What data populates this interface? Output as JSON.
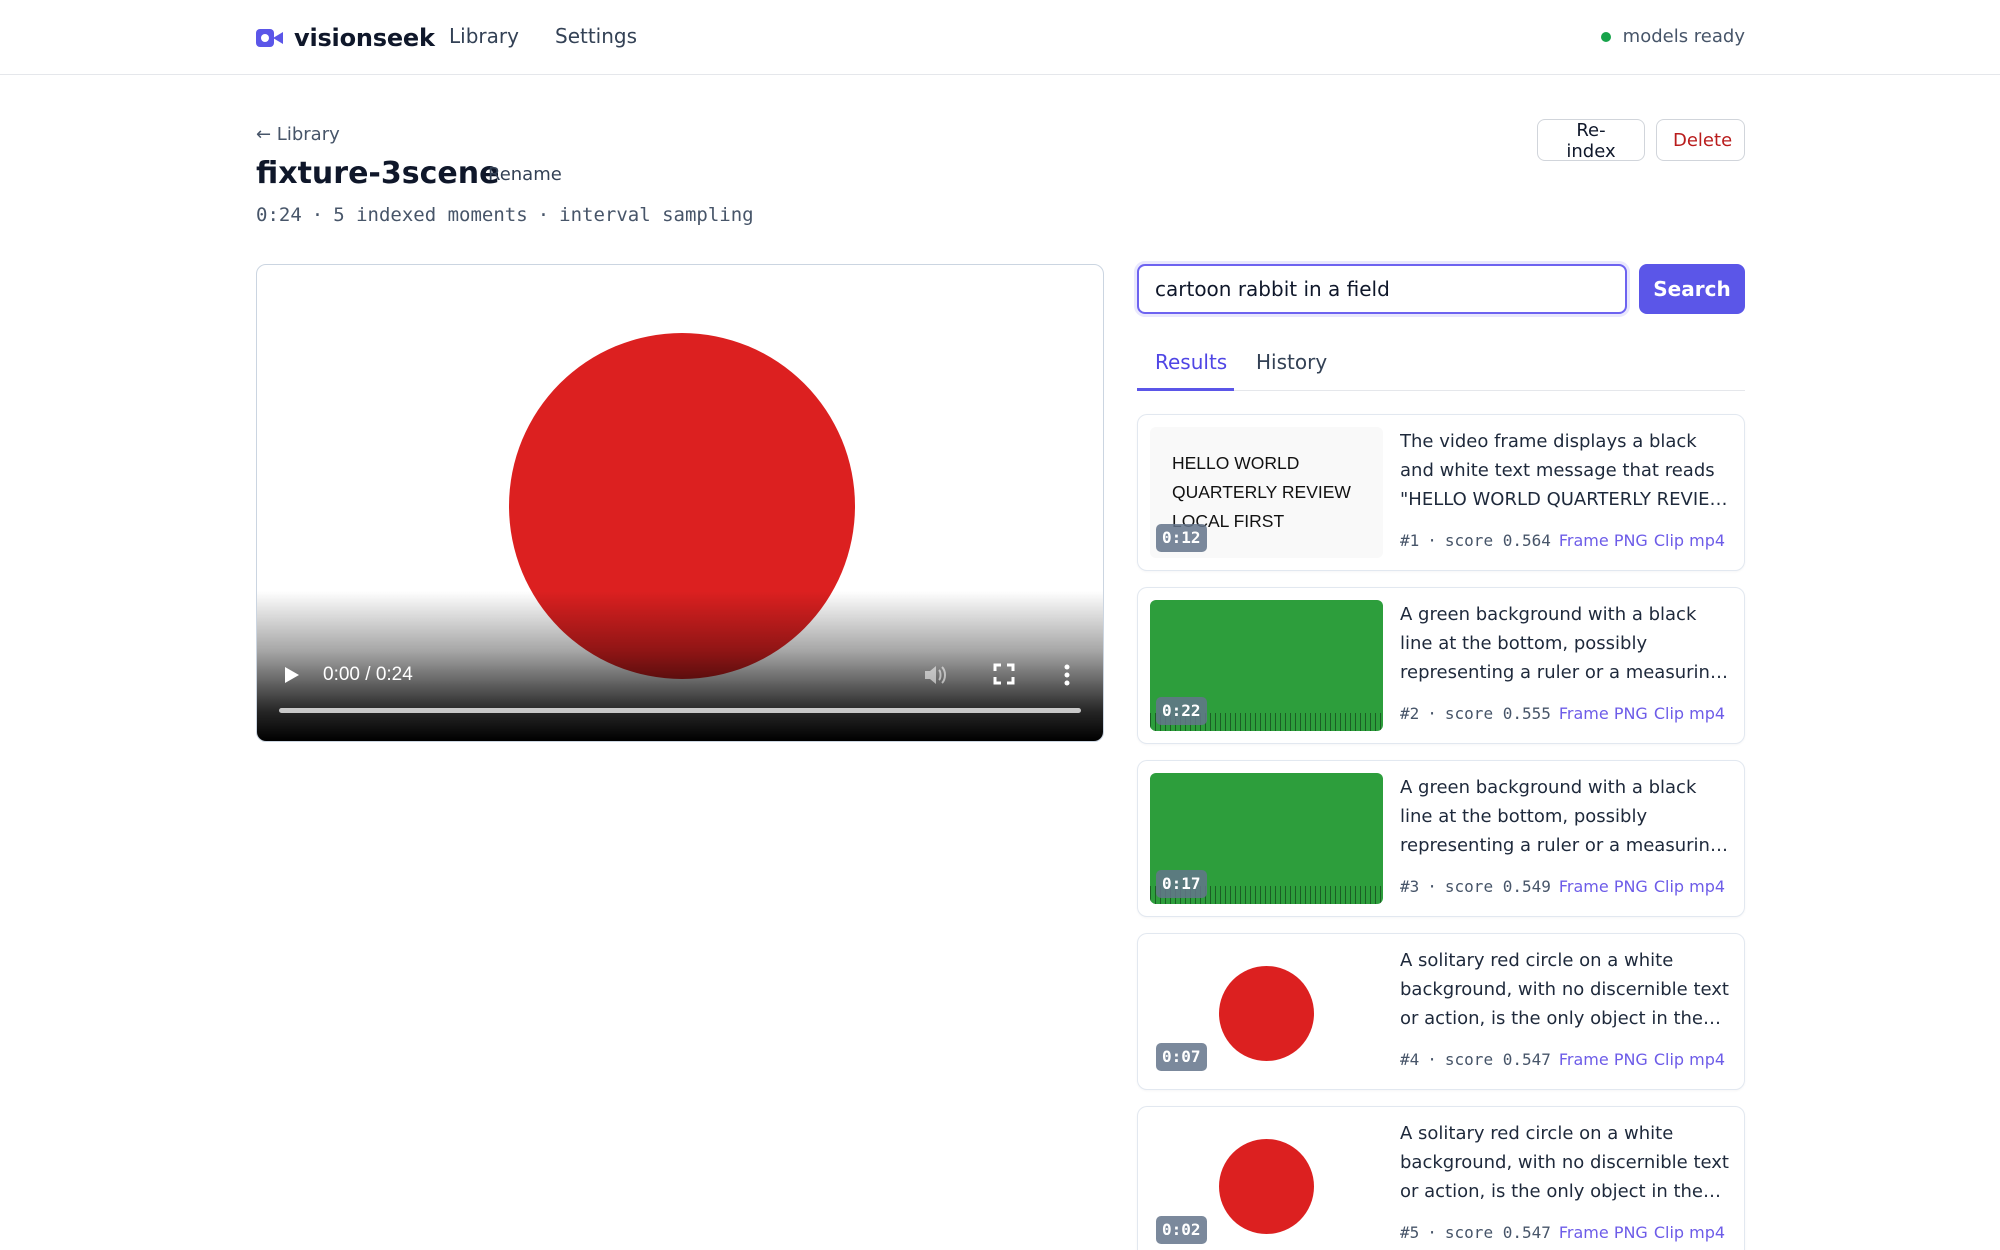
{
  "app": {
    "brand": "visionseek",
    "nav": {
      "library": "Library",
      "settings": "Settings"
    },
    "status": "models ready",
    "status_color": "#16a34a",
    "accent": "#5b56e8"
  },
  "header": {
    "back": "← Library",
    "title": "fixture-3scene",
    "rename": "Rename",
    "meta": {
      "duration": "0:24",
      "moments": "5 indexed moments",
      "sampling": "interval sampling",
      "separator": "·"
    },
    "reindex": "Re-index",
    "delete": "Delete"
  },
  "player": {
    "time": "0:00 / 0:24",
    "icons": [
      "play-icon",
      "volume-icon",
      "fullscreen-icon",
      "more-icon"
    ]
  },
  "search": {
    "query": "cartoon rabbit in a field",
    "button": "Search"
  },
  "tabs": {
    "results": "Results",
    "history": "History",
    "active": "results"
  },
  "results": [
    {
      "timestamp": "0:12",
      "thumb_type": "text",
      "thumb_lines": [
        "HELLO WORLD",
        "QUARTERLY REVIEW",
        "LOCAL FIRST"
      ],
      "description": "The video frame displays a black and white text message that reads \"HELLO WORLD QUARTERLY REVIEW LOCAL FIRST\"",
      "rank": "#1",
      "score": "score 0.564",
      "links": [
        "Frame PNG",
        "Clip mp4"
      ]
    },
    {
      "timestamp": "0:22",
      "thumb_type": "green",
      "description": "A green background with a black line at the bottom, possibly representing a ruler or a measuring tape, is shown in the frame.",
      "rank": "#2",
      "score": "score 0.555",
      "links": [
        "Frame PNG",
        "Clip mp4"
      ]
    },
    {
      "timestamp": "0:17",
      "thumb_type": "green",
      "description": "A green background with a black line at the bottom, possibly representing a ruler or a measuring tape, with no visible text.",
      "rank": "#3",
      "score": "score 0.549",
      "links": [
        "Frame PNG",
        "Clip mp4"
      ]
    },
    {
      "timestamp": "0:07",
      "thumb_type": "circle",
      "description": "A solitary red circle on a white background, with no discernible text or action, is the only object in the frame.",
      "rank": "#4",
      "score": "score 0.547",
      "links": [
        "Frame PNG",
        "Clip mp4"
      ]
    },
    {
      "timestamp": "0:02",
      "thumb_type": "circle",
      "description": "A solitary red circle on a white background, with no discernible text or action, is the only object in the frame.",
      "rank": "#5",
      "score": "score 0.547",
      "links": [
        "Frame PNG",
        "Clip mp4"
      ]
    }
  ]
}
